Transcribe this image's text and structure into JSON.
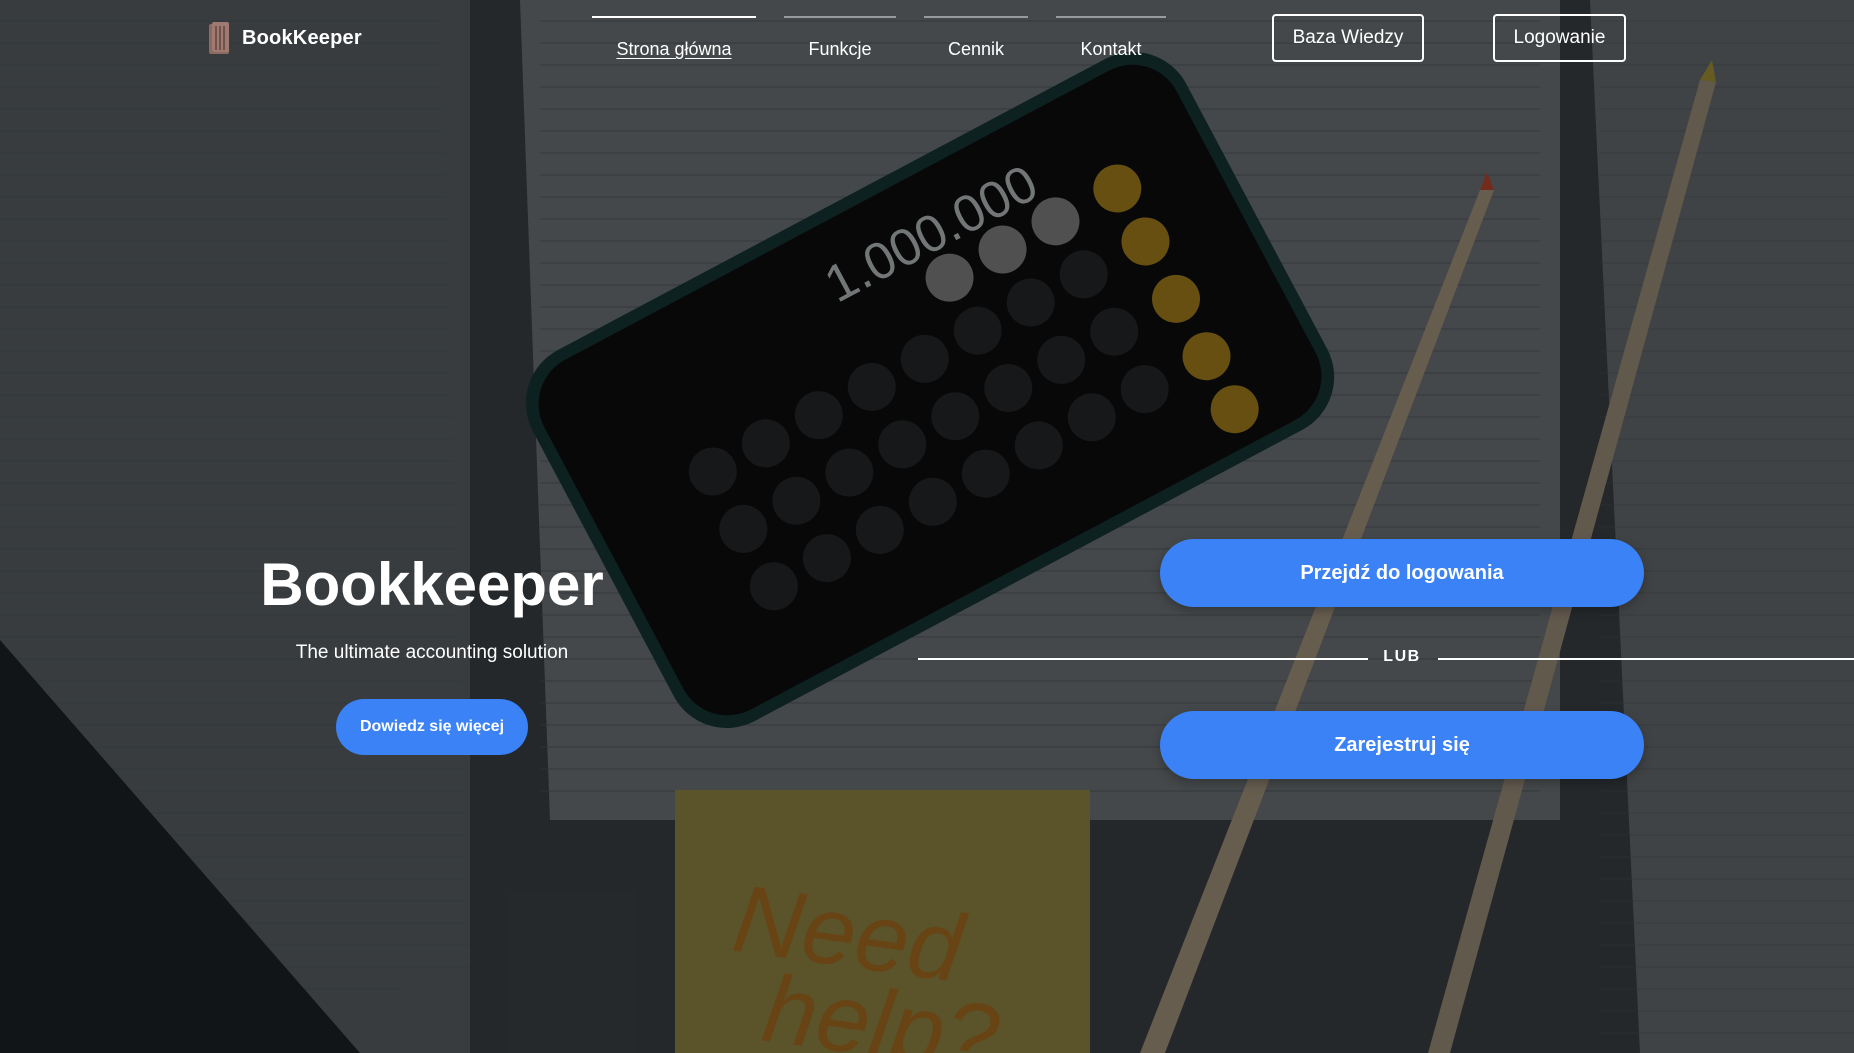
{
  "brand": {
    "name": "BookKeeper",
    "icon": "book-icon"
  },
  "nav": {
    "items": [
      {
        "label": "Strona główna",
        "active": true
      },
      {
        "label": "Funkcje",
        "active": false
      },
      {
        "label": "Cennik",
        "active": false
      },
      {
        "label": "Kontakt",
        "active": false
      }
    ]
  },
  "header_buttons": {
    "knowledge_base": "Baza Wiedzy",
    "login": "Logowanie"
  },
  "hero": {
    "title": "Bookkeeper",
    "subtitle": "The ultimate accounting solution",
    "learn_more": "Dowiedz się więcej"
  },
  "auth": {
    "go_to_login": "Przejdź do logowania",
    "or": "LUB",
    "register": "Zarejestruj się"
  },
  "background": {
    "calculator_display": "1.000.000",
    "sticky_note": "Need help?"
  },
  "colors": {
    "accent": "#3b82f6",
    "text": "#ffffff"
  }
}
